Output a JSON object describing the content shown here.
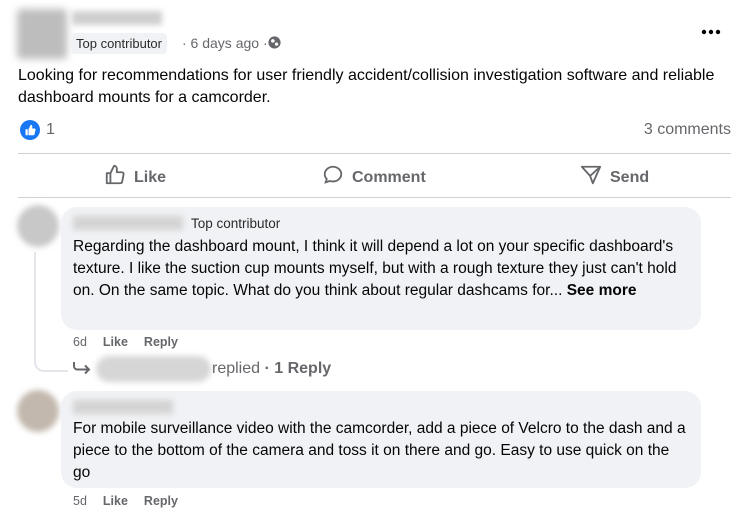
{
  "post": {
    "badge": "Top contributor",
    "time": "· 6 days ago ·",
    "text": "Looking for recommendations for user friendly accident/collision investigation software and reliable dashboard mounts for a camcorder.",
    "reactions_count": "1",
    "comments_count": "3 comments",
    "more_icon": "three-dots-icon",
    "audience_icon": "globe-icon"
  },
  "actions": {
    "like": "Like",
    "comment": "Comment",
    "send": "Send"
  },
  "comments": [
    {
      "badge": "Top contributor",
      "text": "Regarding the dashboard mount, I think it will depend a lot on your specific dashboard's texture. I like the suction cup mounts myself, but with a rough texture they just can't hold on. On the same topic. What do you think about regular dashcams for...",
      "see_more": "See more",
      "time": "6d",
      "like": "Like",
      "reply": "Reply",
      "replies_text": "replied",
      "replies_count": "· 1 Reply"
    },
    {
      "text": "For mobile surveillance video with the camcorder, add a piece of Velcro to the dash and a piece to the bottom of the camera and toss it on there and go. Easy to use quick on the go",
      "time": "5d",
      "like": "Like",
      "reply": "Reply"
    }
  ],
  "colors": {
    "accent": "#1877f2",
    "muted": "#65676b",
    "bubble": "#f0f2f5"
  }
}
